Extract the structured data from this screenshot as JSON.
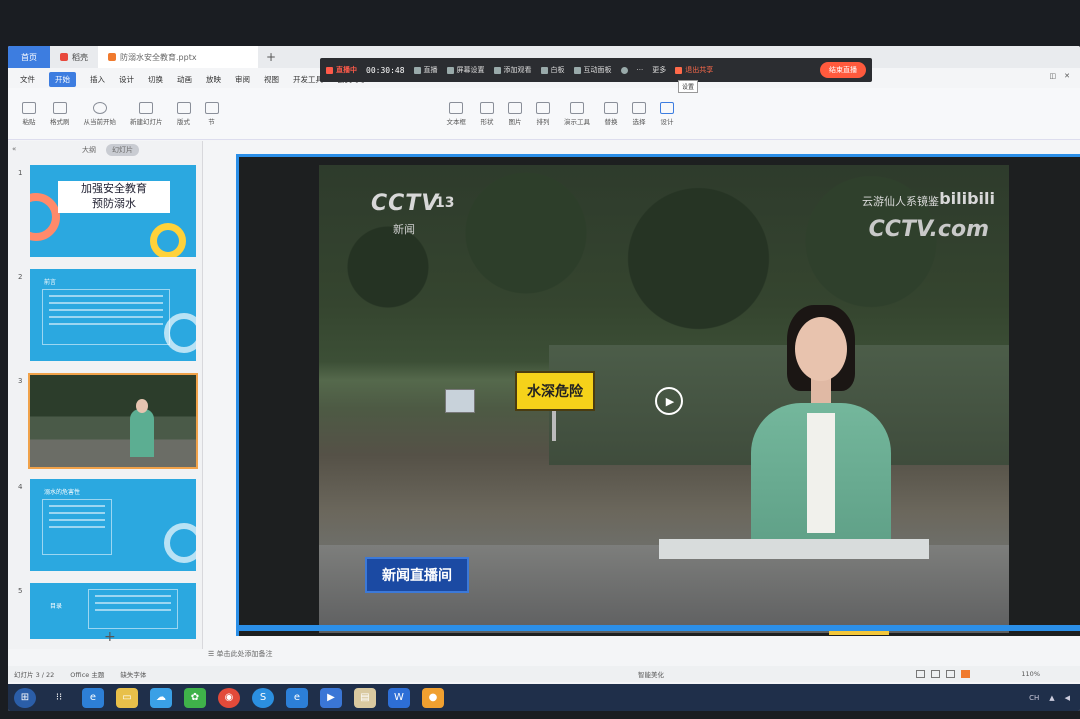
{
  "tabs": [
    {
      "label": "首页",
      "active": true
    },
    {
      "label": "稻壳"
    },
    {
      "label": "防溺水安全教育.pptx"
    }
  ],
  "recording": {
    "status": "直播中",
    "time": "00:30:48",
    "items": [
      "直播",
      "屏幕设置",
      "添加观看",
      "白板",
      "互动面板",
      "···",
      "更多"
    ],
    "exit_share": "退出共享",
    "end_live": "结束直播",
    "tooltip": "设置"
  },
  "menu": [
    "文件",
    "开始",
    "插入",
    "设计",
    "切换",
    "动画",
    "放映",
    "审阅",
    "视图",
    "开发工具",
    "会员专享"
  ],
  "menu_active": "开始",
  "ribbon": [
    "粘贴",
    "格式刷",
    "从当前开始",
    "新建幻灯片",
    "版式",
    "节",
    "文本框",
    "形状",
    "图片",
    "排列",
    "演示工具",
    "替换",
    "选择",
    "设计"
  ],
  "panel": {
    "outline": "大纲",
    "slides": "幻灯片"
  },
  "slide_thumbs": [
    {
      "num": "1",
      "title_line1": "加强安全教育",
      "title_line2": "预防溺水"
    },
    {
      "num": "2",
      "title": "前言"
    },
    {
      "num": "3"
    },
    {
      "num": "4",
      "title": "溺水的危害性"
    },
    {
      "num": "5",
      "title": "目录"
    }
  ],
  "video": {
    "logo": "CCTV",
    "channel": "13",
    "channel_sub": "新闻",
    "watermark": "云游仙人系镜鉴",
    "bili": "bilibili",
    "cctvcom": "CCTV.com",
    "sign": "水深危险",
    "caption": "新闻直播间"
  },
  "notes_placeholder": "单击此处添加备注",
  "status": {
    "slide_info": "幻灯片 3 / 22",
    "theme": "Office 主题",
    "missing": "缺失字体",
    "smart": "智能美化",
    "zoom": "110%"
  },
  "colors": {
    "accent": "#3d7de0",
    "live_end": "#ff5a3d",
    "stage_border": "#2b8fe8",
    "sign_yellow": "#f5d21a"
  }
}
